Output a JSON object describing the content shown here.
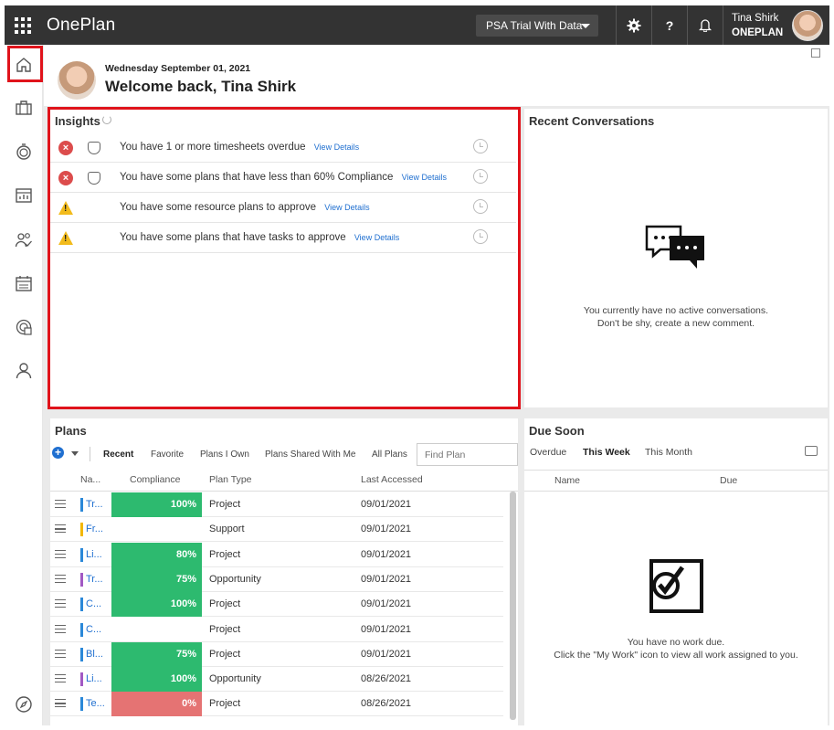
{
  "topbar": {
    "app_title": "OnePlan",
    "plan_selector": "PSA Trial With Data",
    "user_name": "Tina Shirk",
    "org_name": "ONEPLAN",
    "help_label": "?"
  },
  "welcome": {
    "date": "Wednesday September 01, 2021",
    "greeting": "Welcome back, Tina Shirk"
  },
  "insights": {
    "title": "Insights",
    "items": [
      {
        "text": "You have 1 or more timesheets overdue",
        "link": "View Details",
        "status": "error",
        "status_glyph": "×"
      },
      {
        "text": "You have some plans that have less than 60% Compliance",
        "link": "View Details",
        "status": "error",
        "status_glyph": "×"
      },
      {
        "text": "You have some resource plans to approve",
        "link": "View Details",
        "status": "warning",
        "status_glyph": "!"
      },
      {
        "text": "You have some plans that have tasks to approve",
        "link": "View Details",
        "status": "warning",
        "status_glyph": "!"
      }
    ]
  },
  "conversations": {
    "title": "Recent Conversations",
    "empty_line1": "You currently have no active conversations.",
    "empty_line2": "Don't be shy, create a new comment."
  },
  "plans": {
    "title": "Plans",
    "tabs": [
      "Recent",
      "Favorite",
      "Plans I Own",
      "Plans Shared With Me",
      "All Plans"
    ],
    "active_tab": "Recent",
    "search_placeholder": "Find Plan",
    "add_glyph": "+",
    "columns": [
      "Na...",
      "Compliance",
      "Plan Type",
      "Last Accessed"
    ],
    "rows": [
      {
        "name": "Tr...",
        "compliance": "100%",
        "compliance_color": "#2dba6f",
        "type": "Project",
        "date": "09/01/2021",
        "color": "#2b88d8"
      },
      {
        "name": "Fr...",
        "compliance": "",
        "compliance_color": "",
        "type": "Support",
        "date": "09/01/2021",
        "color": "#f2b700"
      },
      {
        "name": "Li...",
        "compliance": "80%",
        "compliance_color": "#2dba6f",
        "type": "Project",
        "date": "09/01/2021",
        "color": "#2b88d8"
      },
      {
        "name": "Tr...",
        "compliance": "75%",
        "compliance_color": "#2dba6f",
        "type": "Opportunity",
        "date": "09/01/2021",
        "color": "#a259c4"
      },
      {
        "name": "C...",
        "compliance": "100%",
        "compliance_color": "#2dba6f",
        "type": "Project",
        "date": "09/01/2021",
        "color": "#2b88d8"
      },
      {
        "name": "C...",
        "compliance": "",
        "compliance_color": "",
        "type": "Project",
        "date": "09/01/2021",
        "color": "#2b88d8"
      },
      {
        "name": "Bl...",
        "compliance": "75%",
        "compliance_color": "#2dba6f",
        "type": "Project",
        "date": "09/01/2021",
        "color": "#2b88d8"
      },
      {
        "name": "Li...",
        "compliance": "100%",
        "compliance_color": "#2dba6f",
        "type": "Opportunity",
        "date": "08/26/2021",
        "color": "#a259c4"
      },
      {
        "name": "Te...",
        "compliance": "0%",
        "compliance_color": "#e57373",
        "type": "Project",
        "date": "08/26/2021",
        "color": "#2b88d8"
      }
    ]
  },
  "due_soon": {
    "title": "Due Soon",
    "tabs": [
      "Overdue",
      "This Week",
      "This Month"
    ],
    "active_tab": "This Week",
    "columns": [
      "Name",
      "Due"
    ],
    "empty_line1": "You have no work due.",
    "empty_line2": "Click the \"My Work\" icon to view all work assigned to you."
  },
  "colors": {
    "topbar_bg": "#333333",
    "highlight": "#e0131b",
    "link": "#1f6fd0",
    "compliance_good": "#2dba6f",
    "compliance_bad": "#e57373"
  }
}
